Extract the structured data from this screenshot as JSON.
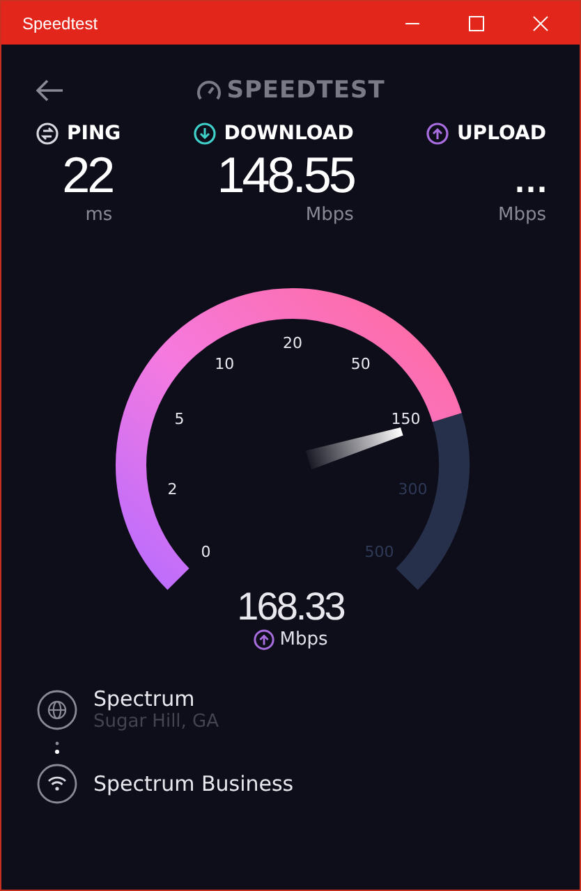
{
  "window": {
    "title": "Speedtest"
  },
  "header": {
    "logo": "SPEEDTEST"
  },
  "stats": [
    {
      "kind": "ping",
      "label": "PING",
      "value": "22",
      "unit": "ms"
    },
    {
      "kind": "download",
      "label": "DOWNLOAD",
      "value": "148.55",
      "unit": "Mbps"
    },
    {
      "kind": "upload",
      "label": "UPLOAD",
      "value": "...",
      "unit": "Mbps"
    }
  ],
  "gauge": {
    "ticks": [
      "0",
      "2",
      "5",
      "10",
      "20",
      "50",
      "150",
      "300",
      "500"
    ],
    "reading": "168.33",
    "unit": "Mbps"
  },
  "connection": {
    "isp": "Spectrum",
    "location": "Sugar Hill, GA",
    "server": "Spectrum Business"
  }
}
